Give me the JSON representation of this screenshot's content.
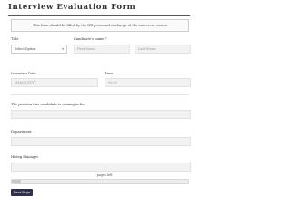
{
  "form": {
    "title": "Interview Evaluation Form",
    "notice": "This form should be filled by the HR personnel in charge of the interview session"
  },
  "fields": {
    "title_label": "Title",
    "title_value": "Select Option",
    "candidate_label": "Candidate's name",
    "required_mark": "*",
    "first_name_placeholder": "First Name",
    "last_name_placeholder": "Last Name",
    "date_label": "Interview Date",
    "date_placeholder": "MM/DD/YYYY",
    "time_label": "Time",
    "time_placeholder": "00:00",
    "position_label": "The position this candidate is coming in for",
    "department_label": "Department",
    "hiring_manager_label": "Hiring Manager"
  },
  "footer": {
    "pages_text": "1 pages left",
    "progress": 0.05,
    "next_button": "Next Page"
  },
  "colors": {
    "button_bg": "#2f2f4a",
    "field_bg": "#f2f2f2",
    "required": "#c0392b"
  }
}
